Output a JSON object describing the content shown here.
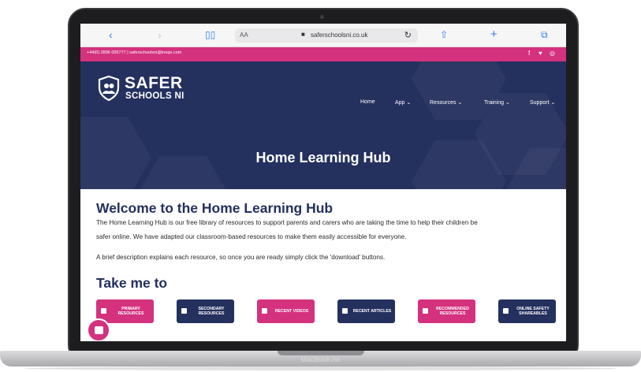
{
  "laptop": {
    "model_label": "MacBook Air"
  },
  "browser": {
    "url": "saferschoolsni.co.uk",
    "reader_label": "AA",
    "icons": [
      "back-icon",
      "forward-icon",
      "book-icon",
      "lock-icon",
      "reload-icon",
      "share-icon",
      "plus-icon",
      "tabs-icon"
    ]
  },
  "topbar": {
    "contact": "+44(0) 2896 005777 | saferschoolsni@ineqe.com",
    "social": [
      "f",
      "♥",
      "◎"
    ]
  },
  "logo": {
    "line1": "SAFER",
    "line2": "SCHOOLS NI"
  },
  "nav": {
    "items": [
      {
        "label": "Home"
      },
      {
        "label": "App ⌄"
      },
      {
        "label": "Resources ⌄"
      },
      {
        "label": "Training ⌄"
      },
      {
        "label": "Support ⌄"
      }
    ]
  },
  "hero": {
    "title": "Home Learning Hub"
  },
  "main": {
    "heading": "Welcome to the Home Learning Hub",
    "paragraph_line1": "The Home Learning Hub is our free library of resources to support parents and carers who are taking the time to help their children be",
    "paragraph_line2": "safer online. We have adapted our classroom-based resources to make them easily accessible for everyone.",
    "paragraph2": "A brief description explains each resource, so once you are ready simply click the 'download' buttons.",
    "take_me_to": "Take me to"
  },
  "quick_links": [
    {
      "label": "PRIMARY RESOURCES",
      "color": "#d4317f"
    },
    {
      "label": "SECONDARY RESOURCES",
      "color": "#24305e"
    },
    {
      "label": "RECENT VIDEOS",
      "color": "#d4317f"
    },
    {
      "label": "RECENT ARTICLES",
      "color": "#24305e"
    },
    {
      "label": "RECOMMENDED RESOURCES",
      "color": "#d4317f"
    },
    {
      "label": "ONLINE SAFETY SHAREABLES",
      "color": "#24305e"
    }
  ],
  "colors": {
    "brand_pink": "#d4317f",
    "brand_navy": "#24305e",
    "safari_blue": "#2f80ed"
  }
}
